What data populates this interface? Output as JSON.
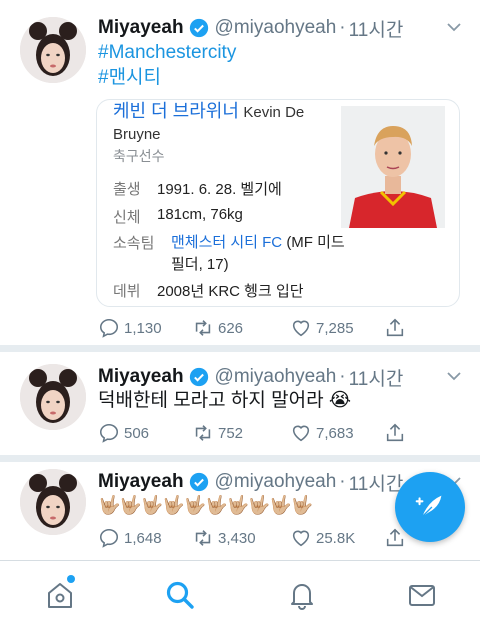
{
  "tweets": [
    {
      "name": "Miyayeah",
      "handle": "@miyaohyeah",
      "time": "11시간",
      "hashtags": [
        "#Manchestercity",
        "#맨시티"
      ],
      "card": {
        "title_ko": "케빈 더 브라위너",
        "title_en": "Kevin De Bruyne",
        "subtitle": "축구선수",
        "rows": [
          {
            "key": "출생",
            "value": "1991. 6. 28. 벨기에"
          },
          {
            "key": "신체",
            "value": "181cm, 76kg"
          },
          {
            "key": "소속팀",
            "link": "맨체스터 시티 FC",
            "value": "(MF 미드필더, 17)"
          },
          {
            "key": "데뷔",
            "value": "2008년 KRC 헹크 입단"
          }
        ]
      },
      "counts": {
        "replies": "1,130",
        "retweets": "626",
        "likes": "7,285"
      }
    },
    {
      "name": "Miyayeah",
      "handle": "@miyaohyeah",
      "time": "11시간",
      "text": "덕배한테 모라고 하지 말어라 😭",
      "counts": {
        "replies": "506",
        "retweets": "752",
        "likes": "7,683"
      }
    },
    {
      "name": "Miyayeah",
      "handle": "@miyaohyeah",
      "time": "11시간",
      "text": "🤟🏼🤟🏼🤟🏼🤟🏼🤟🏼🤟🏼🤟🏼🤟🏼🤟🏼🤟🏼",
      "counts": {
        "replies": "1,648",
        "retweets": "3,430",
        "likes": "25.8K"
      }
    }
  ],
  "nav": {
    "items": [
      "home-icon",
      "search-icon",
      "bell-icon",
      "mail-icon"
    ],
    "active": "search-icon"
  },
  "colors": {
    "accent": "#1da1f2",
    "link": "#1b95e0",
    "muted": "#657786"
  }
}
